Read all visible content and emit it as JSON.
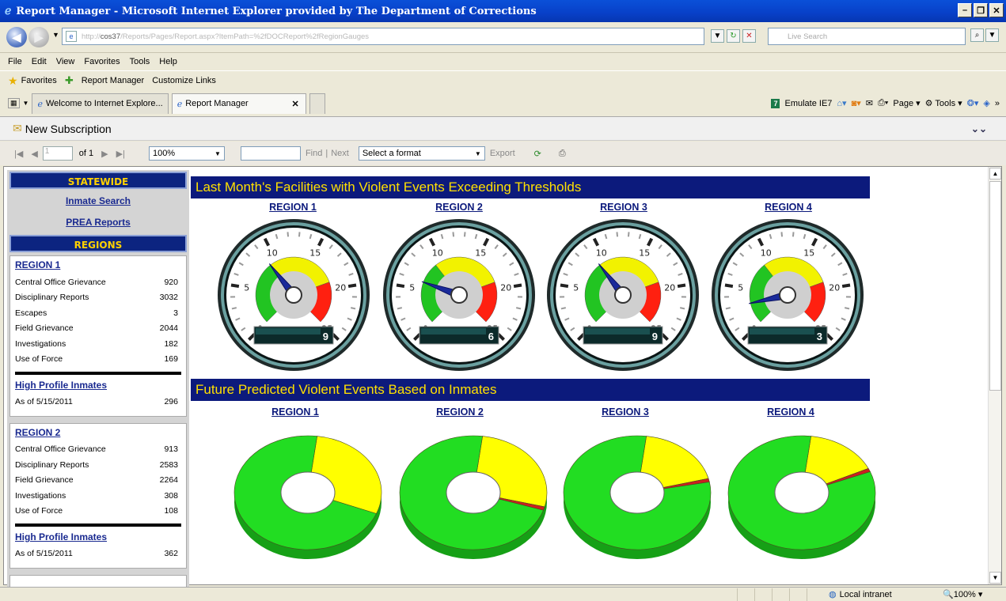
{
  "window": {
    "title": "Report Manager - Microsoft Internet Explorer provided by The Department of Corrections"
  },
  "address": {
    "scheme": "http://",
    "host": "cos37",
    "path": "/Reports/Pages/Report.aspx?ItemPath=%2fDOCReport%2fRegionGauges",
    "search_placeholder": "Live Search"
  },
  "menu": [
    "File",
    "Edit",
    "View",
    "Favorites",
    "Tools",
    "Help"
  ],
  "favorites": {
    "label": "Favorites",
    "links": [
      "Report Manager",
      "Customize Links"
    ]
  },
  "tabs": [
    "Welcome to Internet Explore...",
    "Report Manager"
  ],
  "commandbar": {
    "emulate": "Emulate IE7",
    "page": "Page",
    "tools": "Tools"
  },
  "viewer": {
    "subscription": "New Subscription"
  },
  "pager": {
    "page": "1",
    "of": "of 1",
    "zoom": "100%",
    "find": "Find",
    "sep": "|",
    "next": "Next",
    "format": "Select a format",
    "export": "Export"
  },
  "sidebar": {
    "statewide": "STATEWIDE",
    "inmate_search": "Inmate Search",
    "prea": "PREA Reports",
    "regions_hdr": "REGIONS",
    "regions": [
      {
        "title": "REGION 1",
        "stats": [
          {
            "label": "Central Office Grievance",
            "value": "920"
          },
          {
            "label": "Disciplinary Reports",
            "value": "3032"
          },
          {
            "label": "Escapes",
            "value": "3"
          },
          {
            "label": "Field Grievance",
            "value": "2044"
          },
          {
            "label": "Investigations",
            "value": "182"
          },
          {
            "label": "Use of Force",
            "value": "169"
          }
        ],
        "hpi": "High Profile Inmates",
        "asof_label": "As of  5/15/2011",
        "asof_value": "296"
      },
      {
        "title": "REGION 2",
        "stats": [
          {
            "label": "Central Office Grievance",
            "value": "913"
          },
          {
            "label": "Disciplinary Reports",
            "value": "2583"
          },
          {
            "label": "Field Grievance",
            "value": "2264"
          },
          {
            "label": "Investigations",
            "value": "308"
          },
          {
            "label": "Use of Force",
            "value": "108"
          }
        ],
        "hpi": "High Profile Inmates",
        "asof_label": "As of  5/15/2011",
        "asof_value": "362"
      }
    ]
  },
  "report": {
    "banner1": "Last Month's Facilities with Violent Events Exceeding Thresholds",
    "banner2": "Future Predicted Violent Events Based on Inmates",
    "region_labels": [
      "REGION 1",
      "REGION 2",
      "REGION 3",
      "REGION 4"
    ],
    "gauge_ticks": [
      "0",
      "5",
      "10",
      "15",
      "20",
      "25"
    ]
  },
  "chart_data": [
    {
      "type": "gauge",
      "title": "Last Month's Facilities with Violent Events Exceeding Thresholds",
      "categories": [
        "REGION 1",
        "REGION 2",
        "REGION 3",
        "REGION 4"
      ],
      "values": [
        9,
        6,
        9,
        3
      ],
      "scale": [
        0,
        25
      ],
      "bands": [
        {
          "from": 0,
          "to": 9,
          "color": "#22c422"
        },
        {
          "from": 9,
          "to": 19,
          "color": "#f2f200"
        },
        {
          "from": 19,
          "to": 25,
          "color": "#ff2010"
        }
      ]
    },
    {
      "type": "pie",
      "title": "Future Predicted Violent Events Based on Inmates",
      "categories": [
        "REGION 1",
        "REGION 2",
        "REGION 3",
        "REGION 4"
      ],
      "series": [
        {
          "color": "#22dd22",
          "values": [
            0.71,
            0.72,
            0.8,
            0.83
          ]
        },
        {
          "color": "#ffff00",
          "values": [
            0.29,
            0.27,
            0.19,
            0.16
          ]
        },
        {
          "color": "#cc2020",
          "values": [
            0.0,
            0.01,
            0.01,
            0.01
          ]
        }
      ]
    }
  ],
  "status": {
    "zone": "Local intranet",
    "zoom": "100%"
  }
}
